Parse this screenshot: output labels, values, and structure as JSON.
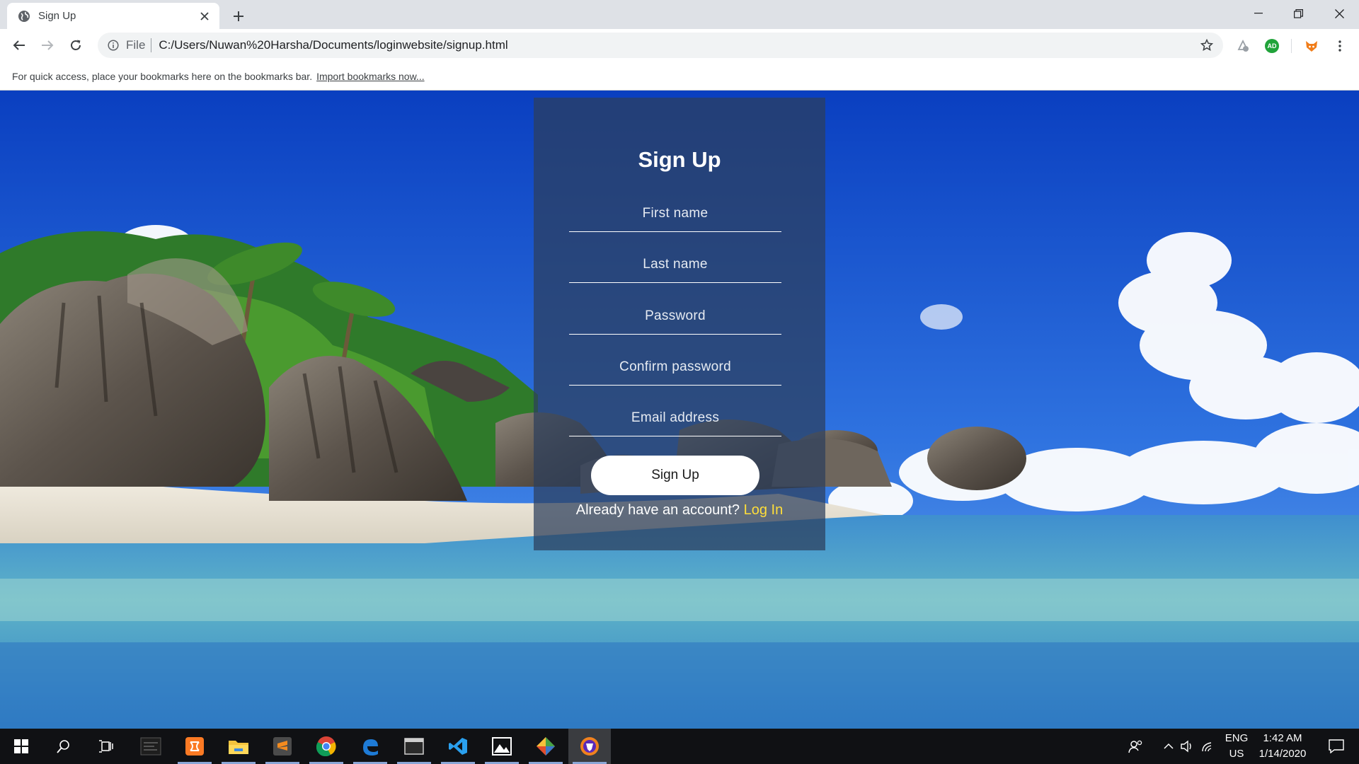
{
  "browser": {
    "tab": {
      "title": "Sign Up"
    },
    "omnibox": {
      "scheme": "File",
      "url": "C:/Users/Nuwan%20Harsha/Documents/loginwebsite/signup.html"
    },
    "bookmarks_bar": {
      "message": "For quick access, place your bookmarks here on the bookmarks bar.",
      "import_link": "Import bookmarks now..."
    },
    "extensions": {
      "adguard_badge": "AD"
    }
  },
  "signup_form": {
    "title": "Sign Up",
    "fields": {
      "first_name": "First name",
      "last_name": "Last name",
      "password": "Password",
      "confirm_password": "Confirm password",
      "email": "Email address"
    },
    "submit_label": "Sign Up",
    "login_prompt": "Already have an account?",
    "login_link": "Log In"
  },
  "taskbar": {
    "language": "ENG",
    "region": "US",
    "time": "1:42 AM",
    "date": "1/14/2020"
  },
  "colors": {
    "accent_link": "#ffde3a",
    "card_overlay": "#2d3e5c",
    "taskbar": "#101114"
  }
}
